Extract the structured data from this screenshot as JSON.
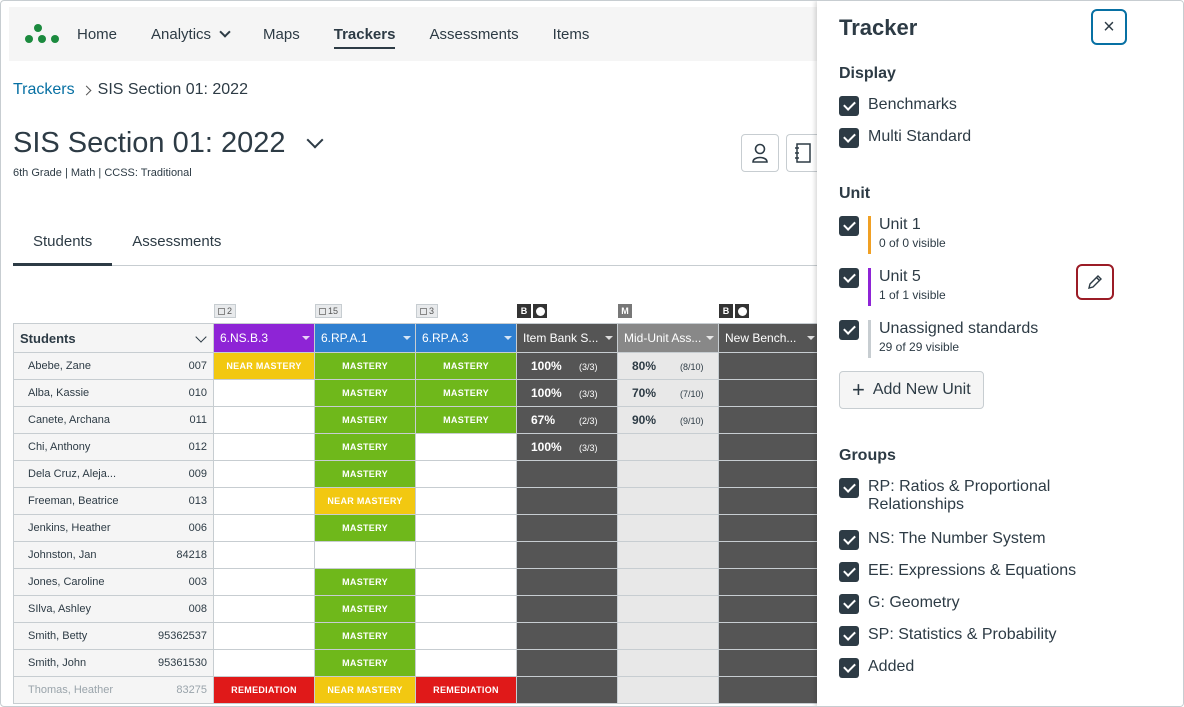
{
  "nav": {
    "items": [
      {
        "label": "Home"
      },
      {
        "label": "Analytics"
      },
      {
        "label": "Maps"
      },
      {
        "label": "Trackers"
      },
      {
        "label": "Assessments"
      },
      {
        "label": "Items"
      }
    ]
  },
  "breadcrumb": {
    "root": "Trackers",
    "current": "SIS Section 01: 2022"
  },
  "page": {
    "title": "SIS Section 01: 2022",
    "subtitle": "6th Grade  |  Math  |  CCSS: Traditional"
  },
  "tabs": [
    {
      "label": "Students"
    },
    {
      "label": "Assessments"
    }
  ],
  "grid": {
    "students_header": "Students",
    "column_meta": [
      {
        "kind": "count",
        "value": "2"
      },
      {
        "kind": "count",
        "value": "15"
      },
      {
        "kind": "count",
        "value": "3"
      },
      {
        "kind": "badge",
        "value": "B"
      },
      {
        "kind": "badge",
        "value": "M"
      },
      {
        "kind": "badge",
        "value": "B"
      }
    ],
    "columns": [
      {
        "label": "6.NS.B.3",
        "color": "#8e24d6"
      },
      {
        "label": "6.RP.A.1",
        "color": "#2f7fd0"
      },
      {
        "label": "6.RP.A.3",
        "color": "#2f7fd0"
      },
      {
        "label": "Item Bank S...",
        "color": "#555555"
      },
      {
        "label": "Mid-Unit Ass...",
        "color": "#888888"
      },
      {
        "label": "New Bench...",
        "color": "#555555"
      }
    ],
    "rows": [
      {
        "name": "Abebe, Zane",
        "id": "007",
        "c1": "NEAR MASTERY",
        "c2": "MASTERY",
        "c3": "MASTERY",
        "ib_pct": "100%",
        "ib_frac": "(3/3)",
        "mu_pct": "80%",
        "mu_frac": "(8/10)"
      },
      {
        "name": "Alba, Kassie",
        "id": "010",
        "c1": "",
        "c2": "MASTERY",
        "c3": "MASTERY",
        "ib_pct": "100%",
        "ib_frac": "(3/3)",
        "mu_pct": "70%",
        "mu_frac": "(7/10)"
      },
      {
        "name": "Canete, Archana",
        "id": "011",
        "c1": "",
        "c2": "MASTERY",
        "c3": "MASTERY",
        "ib_pct": "67%",
        "ib_frac": "(2/3)",
        "mu_pct": "90%",
        "mu_frac": "(9/10)"
      },
      {
        "name": "Chi, Anthony",
        "id": "012",
        "c1": "",
        "c2": "MASTERY",
        "c3": "",
        "ib_pct": "100%",
        "ib_frac": "(3/3)",
        "mu_pct": "",
        "mu_frac": ""
      },
      {
        "name": "Dela Cruz, Aleja...",
        "id": "009",
        "c1": "",
        "c2": "MASTERY",
        "c3": "",
        "ib_pct": "",
        "ib_frac": "",
        "mu_pct": "",
        "mu_frac": ""
      },
      {
        "name": "Freeman, Beatrice",
        "id": "013",
        "c1": "",
        "c2": "NEAR MASTERY",
        "c3": "",
        "ib_pct": "",
        "ib_frac": "",
        "mu_pct": "",
        "mu_frac": ""
      },
      {
        "name": "Jenkins, Heather",
        "id": "006",
        "c1": "",
        "c2": "MASTERY",
        "c3": "",
        "ib_pct": "",
        "ib_frac": "",
        "mu_pct": "",
        "mu_frac": ""
      },
      {
        "name": "Johnston, Jan",
        "id": "84218",
        "c1": "",
        "c2": "",
        "c3": "",
        "ib_pct": "",
        "ib_frac": "",
        "mu_pct": "",
        "mu_frac": ""
      },
      {
        "name": "Jones, Caroline",
        "id": "003",
        "c1": "",
        "c2": "MASTERY",
        "c3": "",
        "ib_pct": "",
        "ib_frac": "",
        "mu_pct": "",
        "mu_frac": ""
      },
      {
        "name": "SIlva, Ashley",
        "id": "008",
        "c1": "",
        "c2": "MASTERY",
        "c3": "",
        "ib_pct": "",
        "ib_frac": "",
        "mu_pct": "",
        "mu_frac": ""
      },
      {
        "name": "Smith, Betty",
        "id": "95362537",
        "c1": "",
        "c2": "MASTERY",
        "c3": "",
        "ib_pct": "",
        "ib_frac": "",
        "mu_pct": "",
        "mu_frac": ""
      },
      {
        "name": "Smith, John",
        "id": "95361530",
        "c1": "",
        "c2": "MASTERY",
        "c3": "",
        "ib_pct": "",
        "ib_frac": "",
        "mu_pct": "",
        "mu_frac": ""
      },
      {
        "name": "Thomas, Heather",
        "id": "83275",
        "c1": "REMEDIATION",
        "c2": "NEAR MASTERY",
        "c3": "REMEDIATION",
        "ib_pct": "",
        "ib_frac": "",
        "mu_pct": "",
        "mu_frac": ""
      }
    ]
  },
  "panel": {
    "title": "Tracker",
    "close": "×",
    "display_title": "Display",
    "display": [
      {
        "label": "Benchmarks"
      },
      {
        "label": "Multi Standard"
      }
    ],
    "unit_title": "Unit",
    "units": [
      {
        "label": "Unit 1",
        "sub": "0 of 0 visible",
        "color": "#f0a024"
      },
      {
        "label": "Unit 5",
        "sub": "1 of 1 visible",
        "color": "#8e24d6"
      },
      {
        "label": "Unassigned standards",
        "sub": "29 of 29 visible",
        "color": "#c7cdd1"
      }
    ],
    "add_unit": "Add New Unit",
    "groups_title": "Groups",
    "groups": [
      {
        "label": "RP: Ratios & Proportional Relationships"
      },
      {
        "label": "NS: The Number System"
      },
      {
        "label": "EE: Expressions & Equations"
      },
      {
        "label": "G: Geometry"
      },
      {
        "label": "SP: Statistics & Probability"
      },
      {
        "label": "Added"
      }
    ]
  }
}
